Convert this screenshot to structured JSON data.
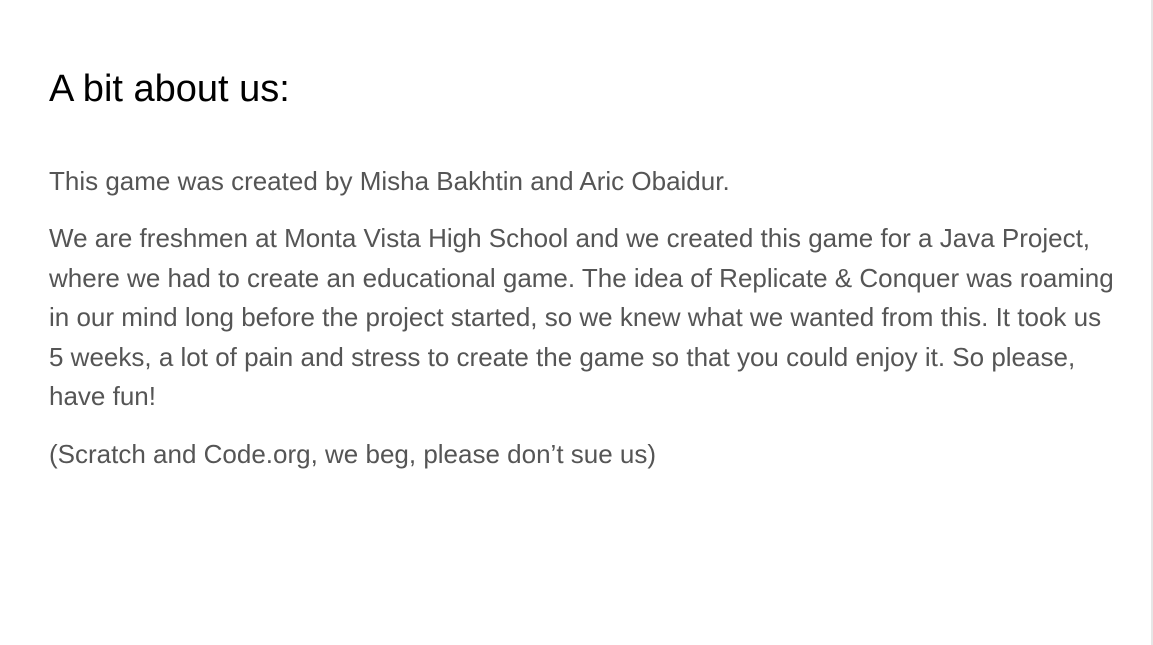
{
  "page": {
    "heading": "A bit about us:",
    "paragraphs": {
      "creators": "This game was created by Misha Bakhtin and Aric Obaidur.",
      "story": "We are freshmen at Monta Vista High School and we created this game for a Java Project, where we had to create an educational game. The idea of Replicate & Conquer was roaming in our mind long before the project started, so we knew what we wanted from this. It took us 5 weeks, a lot of pain and stress to create the game so that you could enjoy it. So please, have fun!",
      "disclaimer": "(Scratch and Code.org, we beg, please don’t sue us)"
    }
  },
  "colors": {
    "heading": "#000000",
    "body_text": "#555555",
    "background": "#ffffff"
  }
}
